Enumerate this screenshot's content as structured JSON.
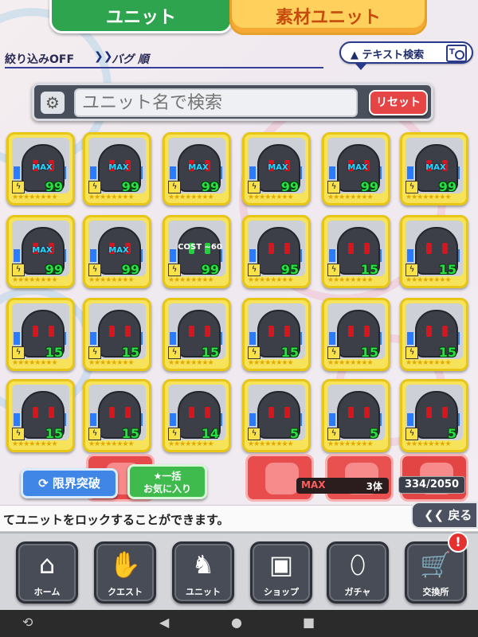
{
  "tabs": {
    "unit": "ユニット",
    "material": "素材ユニット"
  },
  "filter": {
    "status": "絞り込みOFF",
    "sort": "バグ 順",
    "text_search": "テキスト検索",
    "text_search_icon": "T"
  },
  "search": {
    "placeholder": "ユニット名で検索",
    "reset_label": "リセット",
    "settings_icon": "gear-icon"
  },
  "units": [
    {
      "badge": "MAX",
      "level": "99",
      "eyes": "red"
    },
    {
      "badge": "MAX",
      "level": "99",
      "eyes": "red"
    },
    {
      "badge": "MAX",
      "level": "99",
      "eyes": "red"
    },
    {
      "badge": "MAX",
      "level": "99",
      "eyes": "red"
    },
    {
      "badge": "MAX",
      "level": "99",
      "eyes": "red"
    },
    {
      "badge": "MAX",
      "level": "99",
      "eyes": "red"
    },
    {
      "badge": "MAX",
      "level": "99",
      "eyes": "red"
    },
    {
      "badge": "MAX",
      "level": "99",
      "eyes": "red"
    },
    {
      "badge": "COST ~60",
      "level": "99",
      "eyes": "green"
    },
    {
      "badge": "",
      "level": "95",
      "eyes": "red"
    },
    {
      "badge": "",
      "level": "15",
      "eyes": "red"
    },
    {
      "badge": "",
      "level": "15",
      "eyes": "red"
    },
    {
      "badge": "",
      "level": "15",
      "eyes": "red"
    },
    {
      "badge": "",
      "level": "15",
      "eyes": "red"
    },
    {
      "badge": "",
      "level": "15",
      "eyes": "red"
    },
    {
      "badge": "",
      "level": "15",
      "eyes": "red"
    },
    {
      "badge": "",
      "level": "15",
      "eyes": "red"
    },
    {
      "badge": "",
      "level": "15",
      "eyes": "red"
    },
    {
      "badge": "",
      "level": "15",
      "eyes": "red"
    },
    {
      "badge": "",
      "level": "15",
      "eyes": "red"
    },
    {
      "badge": "",
      "level": "14",
      "eyes": "red"
    },
    {
      "badge": "",
      "level": "5",
      "eyes": "red"
    },
    {
      "badge": "",
      "level": "5",
      "eyes": "red"
    },
    {
      "badge": "",
      "level": "5",
      "eyes": "red"
    }
  ],
  "actions": {
    "limit_break": "限界突破",
    "favorite_line1": "★一括",
    "favorite_line2": "お気に入り"
  },
  "stats": {
    "max_label": "MAX",
    "max_count": "3体",
    "unit_count": "334/2050"
  },
  "message": "てユニットをロックすることができます。",
  "back_label": "戻る",
  "nav": [
    {
      "label": "ホーム",
      "icon": "home-icon",
      "glyph": "⌂"
    },
    {
      "label": "クエスト",
      "icon": "handshake-icon",
      "glyph": "✋"
    },
    {
      "label": "ユニット",
      "icon": "rabbit-icon",
      "glyph": "♞"
    },
    {
      "label": "ショップ",
      "icon": "box-icon",
      "glyph": "▣"
    },
    {
      "label": "ガチャ",
      "icon": "egg-icon",
      "glyph": "⬯"
    },
    {
      "label": "交換所",
      "icon": "cart-icon",
      "glyph": "🛒"
    }
  ],
  "notification": "!"
}
